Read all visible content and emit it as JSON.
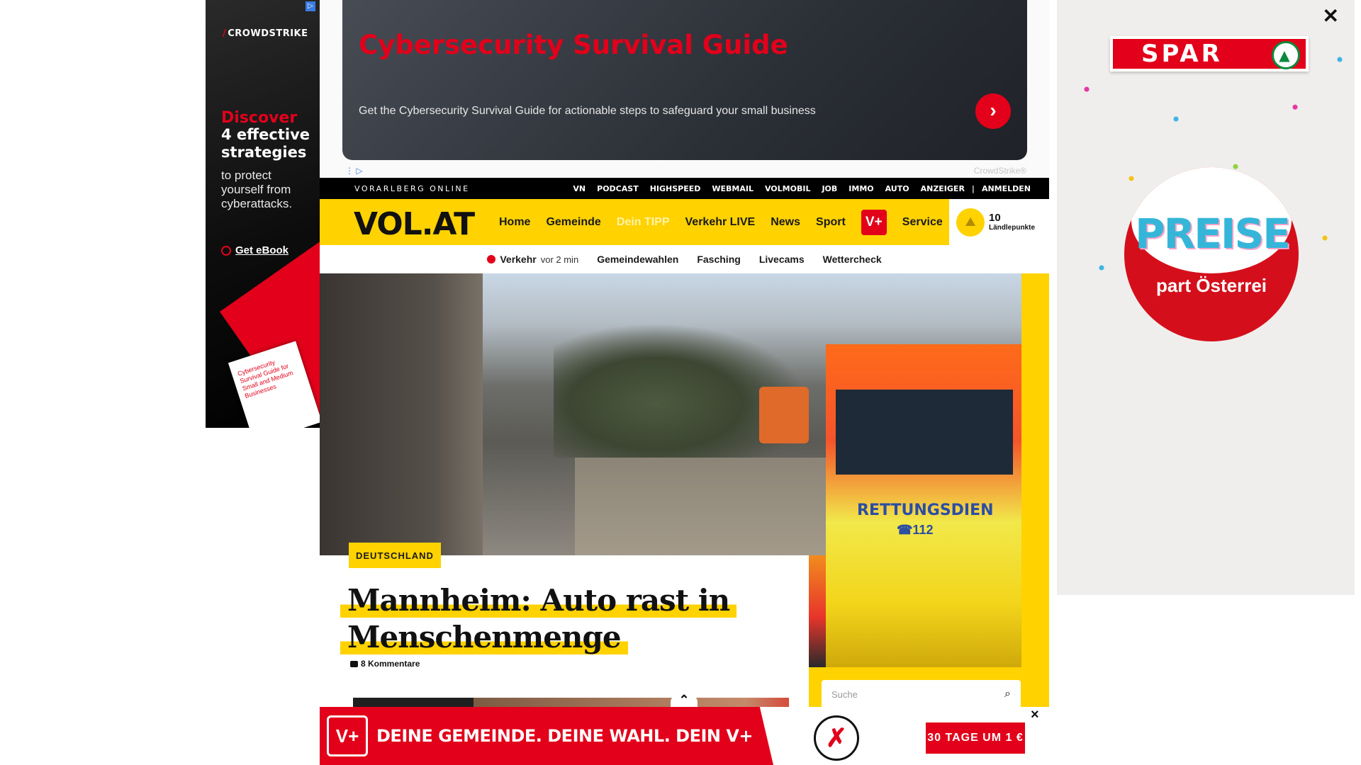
{
  "left_ad": {
    "brand": "CROWDSTRIKE",
    "headline_red": "Discover",
    "headline_white": "4 effective strategies",
    "body": "to protect yourself from cyberattacks.",
    "cta": "Get eBook",
    "book_text": "Cybersecurity Survival Guide for Small and Medium Businesses",
    "bg_color": "#000000",
    "accent": "#e2001a"
  },
  "top_ad": {
    "title": "Cybersecurity Survival Guide",
    "description": "Get the Cybersecurity Survival Guide for actionable steps to safeguard your small business",
    "advertiser": "CrowdStrike®",
    "arrow_icon": "chevron-right-icon"
  },
  "topbar": {
    "brandline": "VORARLBERG ONLINE",
    "links": [
      "VN",
      "PODCAST",
      "HIGHSPEED",
      "WEBMAIL",
      "VOLMOBIL",
      "JOB",
      "IMMO",
      "AUTO",
      "ANZEIGER"
    ],
    "separator": "|",
    "login": "ANMELDEN"
  },
  "mainnav": {
    "logo": "VOL.AT",
    "items": [
      "Home",
      "Gemeinde",
      "Dein TIPP",
      "Verkehr LIVE",
      "News",
      "Sport"
    ],
    "vplus": "V+",
    "service": "Service",
    "points_value": "10",
    "points_label": "Ländlepunkte",
    "accent": "#ffd200"
  },
  "subnav": {
    "live_label": "Verkehr",
    "live_time": "vor 2 min",
    "items": [
      "Gemeindewahlen",
      "Fasching",
      "Livecams",
      "Wettercheck"
    ]
  },
  "article": {
    "category": "DEUTSCHLAND",
    "headline_line1": "Mannheim: Auto rast in",
    "headline_line2": "Menschenmenge",
    "comments": "8 Kommentare",
    "ambulance_text": "RETTUNGSDIEN",
    "ambulance_number": "☎112"
  },
  "search": {
    "placeholder": "Suche"
  },
  "bottom_ad": {
    "vplus": "V+",
    "slogan": "DEINE GEMEINDE. DEINE WAHL. DEIN V+",
    "cta": "30 TAGE UM 1 €",
    "close": "×"
  },
  "right_ad": {
    "brand": "SPAR",
    "disc_word": "PREISE",
    "disc_sub": "part Österrei",
    "close": "✕"
  }
}
